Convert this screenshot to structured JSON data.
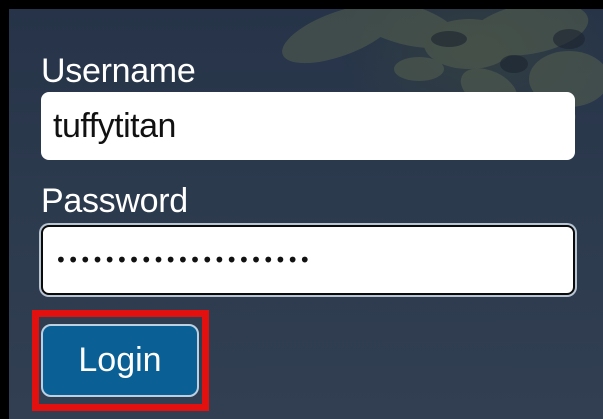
{
  "login_form": {
    "username_label": "Username",
    "username_value": "tuffytitan",
    "password_label": "Password",
    "password_mask": "•••••••••••••••••••••",
    "login_button": "Login"
  },
  "colors": {
    "background": "#2c3a4e",
    "button": "#0a5f95",
    "highlight": "#e31010"
  }
}
